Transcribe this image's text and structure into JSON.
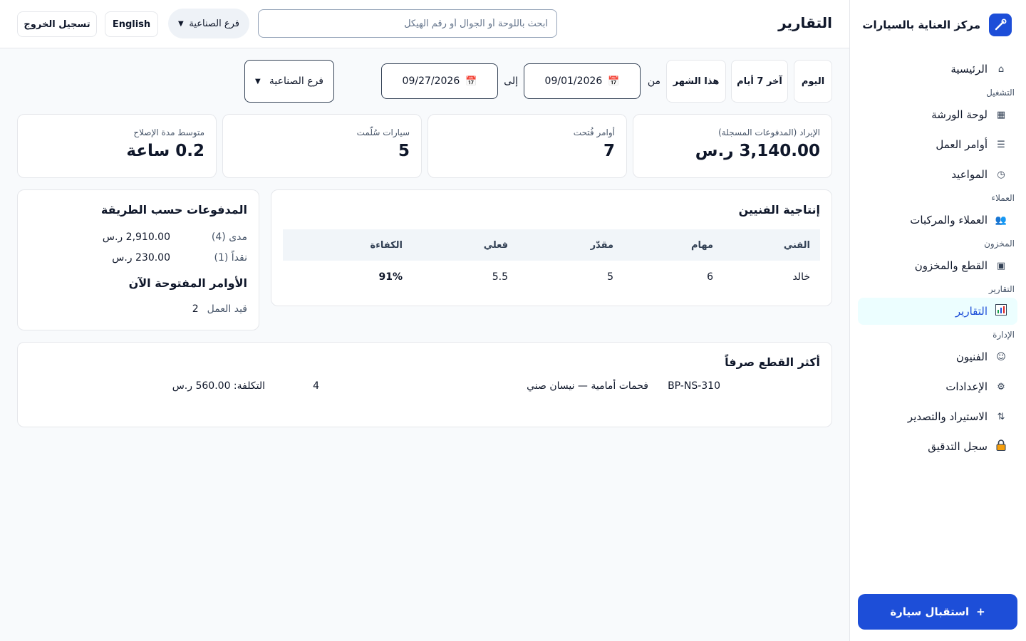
{
  "app": {
    "brand": "مركز العناية بالسيارات",
    "page_title": "التقارير"
  },
  "topbar": {
    "search_placeholder": "ابحث باللوحة أو الجوال أو رقم الهيكل",
    "branch": "فرع الصناعية",
    "language_button": "English",
    "logout_button": "تسجيل الخروج"
  },
  "sidebar": {
    "home": "الرئيسية",
    "sections": [
      {
        "title": "التشغيل",
        "items": [
          "لوحة الورشة",
          "أوامر العمل",
          "المواعيد"
        ]
      },
      {
        "title": "العملاء",
        "items": [
          "العملاء والمركبات"
        ]
      },
      {
        "title": "المخزون",
        "items": [
          "القطع والمخزون"
        ]
      },
      {
        "title": "التقارير",
        "items": [
          "التقارير"
        ]
      },
      {
        "title": "الإدارة",
        "items": [
          "الفنيون",
          "الإعدادات",
          "الاستيراد والتصدير",
          "سجل التدقيق"
        ]
      }
    ],
    "receive_button": "استقبال سيارة",
    "receive_icon": "+"
  },
  "filters": {
    "today": "اليوم",
    "last7": "آخر 7 أيام",
    "this_month": "هذا الشهر",
    "from_label": "من",
    "from_date": "09/01/2026",
    "to_label": "إلى",
    "to_date": "09/27/2026",
    "branch": "فرع الصناعية"
  },
  "kpis": [
    {
      "label": "الإيراد (المدفوعات المسجلة)",
      "value": "3,140.00 ر.س"
    },
    {
      "label": "أوامر فُتحت",
      "value": "7"
    },
    {
      "label": "سيارات سُلّمت",
      "value": "5"
    },
    {
      "label": "متوسط مدة الإصلاح",
      "value": "0.2 ساعة"
    }
  ],
  "tech_productivity": {
    "title": "إنتاجية الفنيين",
    "headers": [
      "الفني",
      "مهام",
      "مقدّر",
      "فعلي",
      "الكفاءة"
    ],
    "rows": [
      [
        "خالد",
        "6",
        "5",
        "5.5",
        "91%"
      ]
    ]
  },
  "payments": {
    "title": "المدفوعات حسب الطريقة",
    "rows": [
      {
        "method": "مدى",
        "count": "(4)",
        "amount": "2,910.00 ر.س"
      },
      {
        "method": "نقداً",
        "count": "(1)",
        "amount": "230.00 ر.س"
      }
    ]
  },
  "open_orders": {
    "title": "الأوامر المفتوحة الآن",
    "rows": [
      {
        "status": "قيد العمل",
        "count": "2"
      }
    ]
  },
  "top_parts": {
    "title": "أكثر القطع صرفاً",
    "rows": [
      {
        "sku": "BP-NS-310",
        "name": "فحمات أمامية — نيسان صني",
        "qty": "4",
        "cost": "التكلفة: 560.00 ر.س"
      }
    ]
  },
  "colors": {
    "accent": "#1d4ed8",
    "active_bg": "#ecfeff",
    "border": "#e5e7eb"
  }
}
